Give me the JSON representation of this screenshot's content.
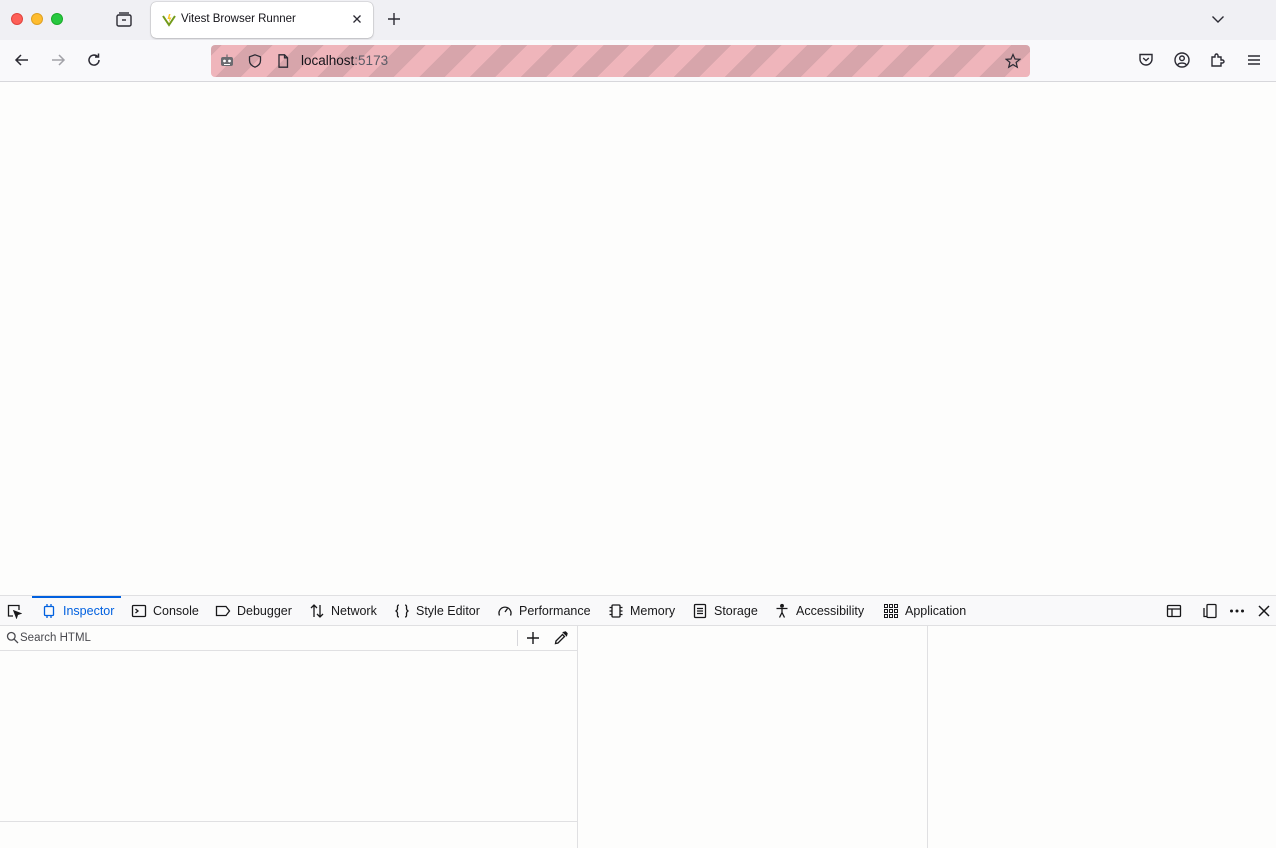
{
  "browser": {
    "tab": {
      "title": "Vitest Browser Runner",
      "favicon": "vitest-logo-icon"
    },
    "url": {
      "host": "localhost",
      "port": ":5173"
    }
  },
  "devtools": {
    "tabs": [
      {
        "label": "Inspector",
        "icon": "inspector-icon",
        "selected": true
      },
      {
        "label": "Console",
        "icon": "console-icon"
      },
      {
        "label": "Debugger",
        "icon": "debugger-icon"
      },
      {
        "label": "Network",
        "icon": "network-icon"
      },
      {
        "label": "Style Editor",
        "icon": "style-editor-icon"
      },
      {
        "label": "Performance",
        "icon": "performance-icon"
      },
      {
        "label": "Memory",
        "icon": "memory-icon"
      },
      {
        "label": "Storage",
        "icon": "storage-icon"
      },
      {
        "label": "Accessibility",
        "icon": "accessibility-icon"
      },
      {
        "label": "Application",
        "icon": "application-icon"
      }
    ],
    "search": {
      "placeholder": "Search HTML"
    }
  },
  "colors": {
    "accent": "#0060df",
    "url_stripe_a": "#efb5bb",
    "url_stripe_b": "#d7a5ab"
  }
}
